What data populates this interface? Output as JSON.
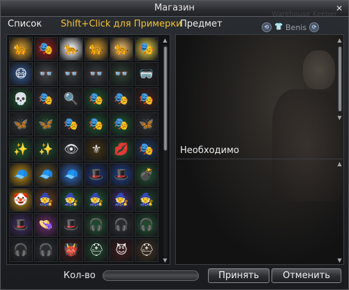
{
  "window": {
    "title": "Магазин",
    "close_glyph": "✕"
  },
  "header": {
    "list_label": "Список",
    "hint_label": "Shift+Click для Примерки",
    "item_label": "Предмет",
    "ghost_text": "Warehouse Keeper",
    "player_name": "Benis"
  },
  "preview": {
    "needed_label": "Необходимо"
  },
  "footer": {
    "qty_label": "Кол-во",
    "qty_value": "",
    "accept_label": "Принять",
    "cancel_label": "Отменить"
  },
  "items": [
    {
      "icon": "leopard-mask-icon",
      "glyph": "🐆",
      "bg": "#b8862a"
    },
    {
      "icon": "teal-eye-mask-icon",
      "glyph": "🎭",
      "bg": "#7a1f1f"
    },
    {
      "icon": "leopard-mask-icon",
      "glyph": "🐆",
      "bg": "#d8d8d8"
    },
    {
      "icon": "leopard-mask-icon",
      "glyph": "🐆",
      "bg": "#b8862a"
    },
    {
      "icon": "leopard-mask-icon",
      "glyph": "🐆",
      "bg": "#c9a05a"
    },
    {
      "icon": "teal-eye-mask-icon",
      "glyph": "🎭",
      "bg": "#c0b040"
    },
    {
      "icon": "blue-medical-mask-icon",
      "glyph": "😷",
      "bg": "#2e4d7a"
    },
    {
      "icon": "red-glasses-icon",
      "glyph": "👓",
      "bg": "#3a3d41"
    },
    {
      "icon": "blue-glasses-icon",
      "glyph": "👓",
      "bg": "#2f3336"
    },
    {
      "icon": "gold-glasses-icon",
      "glyph": "👓",
      "bg": "#31353a"
    },
    {
      "icon": "gold-glasses-icon",
      "glyph": "👓",
      "bg": "#2a3a2e"
    },
    {
      "icon": "dark-goggles-icon",
      "glyph": "🥽",
      "bg": "#202224"
    },
    {
      "icon": "skull-face-icon",
      "glyph": "💀",
      "bg": "#1f4a2e"
    },
    {
      "icon": "white-eye-mask-icon",
      "glyph": "🎭",
      "bg": "#2d2f33"
    },
    {
      "icon": "monocle-icon",
      "glyph": "🔍",
      "bg": "#252729"
    },
    {
      "icon": "white-eye-mask-icon",
      "glyph": "🎭",
      "bg": "#1f4a2e"
    },
    {
      "icon": "white-eye-mask-icon",
      "glyph": "🎭",
      "bg": "#2a2d30"
    },
    {
      "icon": "red-eye-mask-icon",
      "glyph": "🎭",
      "bg": "#3a2020"
    },
    {
      "icon": "red-feather-mask-icon",
      "glyph": "🦋",
      "bg": "#2a2d30"
    },
    {
      "icon": "red-feather-mask-icon",
      "glyph": "🦋",
      "bg": "#1f3d2a"
    },
    {
      "icon": "gold-face-mask-icon",
      "glyph": "🎭",
      "bg": "#26282b"
    },
    {
      "icon": "gold-ornate-mask-icon",
      "glyph": "🎭",
      "bg": "#1f4a2e"
    },
    {
      "icon": "silver-ornate-mask-icon",
      "glyph": "🎭",
      "bg": "#1f4a2e"
    },
    {
      "icon": "red-feather-mask-icon",
      "glyph": "🦋",
      "bg": "#2a2d30"
    },
    {
      "icon": "jeweled-mask-icon",
      "glyph": "✨",
      "bg": "#1f4a2e"
    },
    {
      "icon": "jeweled-mask-icon",
      "glyph": "✨",
      "bg": "#1f3d2a"
    },
    {
      "icon": "eye-makeup-icon",
      "glyph": "👁",
      "bg": "#2a2d30"
    },
    {
      "icon": "gold-ornament-icon",
      "glyph": "⚜",
      "bg": "#3a2e15"
    },
    {
      "icon": "green-lips-icon",
      "glyph": "💋",
      "bg": "#1f4a2e"
    },
    {
      "icon": "blue-gold-mask-icon",
      "glyph": "🎭",
      "bg": "#1e3556"
    },
    {
      "icon": "yellow-cap-icon",
      "glyph": "🧢",
      "bg": "#a07818"
    },
    {
      "icon": "black-cap-icon",
      "glyph": "🧢",
      "bg": "#5a4a28"
    },
    {
      "icon": "blue-white-cap-icon",
      "glyph": "🧢",
      "bg": "#2e5aa0"
    },
    {
      "icon": "star-top-hat-icon",
      "glyph": "🎩",
      "bg": "#1d2f6a"
    },
    {
      "icon": "checkered-top-hat-icon",
      "glyph": "🎩",
      "bg": "#1e3a7a"
    },
    {
      "icon": "skull-bomb-icon",
      "glyph": "💣",
      "bg": "#1f4a2e"
    },
    {
      "icon": "jester-hat-icon",
      "glyph": "🤡",
      "bg": "#a07818"
    },
    {
      "icon": "witch-hat-brown-icon",
      "glyph": "🧙",
      "bg": "#5a3a20"
    },
    {
      "icon": "witch-hat-red-icon",
      "glyph": "🧙",
      "bg": "#1f4a2e"
    },
    {
      "icon": "witch-hat-blue-icon",
      "glyph": "🧙",
      "bg": "#1f4a2e"
    },
    {
      "icon": "witch-hat-purple-icon",
      "glyph": "🧙",
      "bg": "#3a2a5a"
    },
    {
      "icon": "witch-hat-red-icon",
      "glyph": "🧙",
      "bg": "#1f3d2a"
    },
    {
      "icon": "purple-hat-icon",
      "glyph": "🎩",
      "bg": "#3a2a5a"
    },
    {
      "icon": "flower-hat-icon",
      "glyph": "👒",
      "bg": "#5a2a5a"
    },
    {
      "icon": "fur-hat-icon",
      "glyph": "🎩",
      "bg": "#2a2d30"
    },
    {
      "icon": "headphones-icon",
      "glyph": "🎧",
      "bg": "#1f4a2e"
    },
    {
      "icon": "headphones-icon",
      "glyph": "🎧",
      "bg": "#2a2d30"
    },
    {
      "icon": "headphones-icon",
      "glyph": "🎧",
      "bg": "#1f4a2e"
    },
    {
      "icon": "headphones-icon",
      "glyph": "🎧",
      "bg": "#26282b"
    },
    {
      "icon": "headphones-icon",
      "glyph": "🎧",
      "bg": "#2a2d30"
    },
    {
      "icon": "demon-helm-icon",
      "glyph": "👹",
      "bg": "#3a1a1a"
    },
    {
      "icon": "dark-helm-icon",
      "glyph": "⛑",
      "bg": "#1f3d2a"
    },
    {
      "icon": "horns-icon",
      "glyph": "😈",
      "bg": "#3a1a1a"
    },
    {
      "icon": "bronze-helm-icon",
      "glyph": "⛑",
      "bg": "#3a2e20"
    }
  ]
}
